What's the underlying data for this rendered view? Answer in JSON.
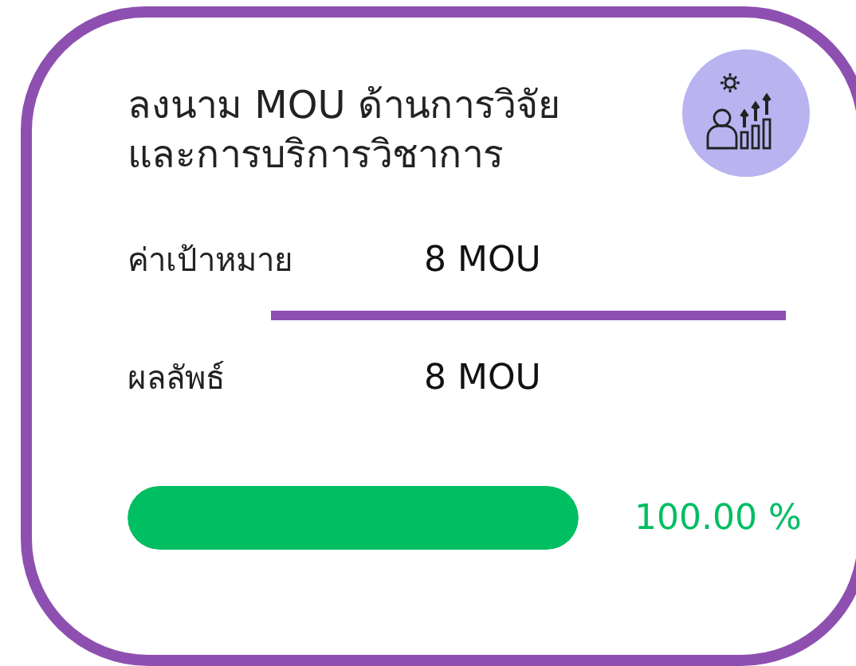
{
  "card": {
    "title_lines": [
      "ลงนาม MOU ด้านการวิจัย",
      "และการบริการวิชาการ"
    ],
    "rows": [
      {
        "label": "ค่าเป้าหมาย",
        "value": "8 MOU"
      },
      {
        "label": "ผลลัพธ์",
        "value": "8 MOU"
      }
    ],
    "progress": {
      "level": 1,
      "reading": "100.00 %"
    }
  }
}
